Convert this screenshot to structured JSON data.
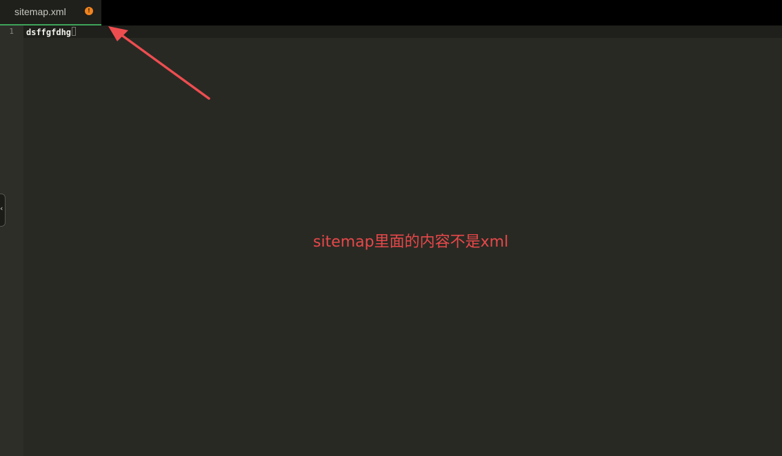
{
  "tab": {
    "label": "sitemap.xml",
    "status_icon": "warning-dot-icon",
    "status_glyph": "!",
    "status_color": "#f0831e",
    "active_underline_color": "#3ea55a"
  },
  "editor": {
    "line_number": "1",
    "line_text": "dsffgfdhg"
  },
  "side_handle": {
    "icon": "chevron-left-icon",
    "glyph": "‹"
  },
  "annotation": {
    "text": "sitemap里面的内容不是xml",
    "color": "#e8484a",
    "arrow_icon": "red-arrow-icon"
  }
}
